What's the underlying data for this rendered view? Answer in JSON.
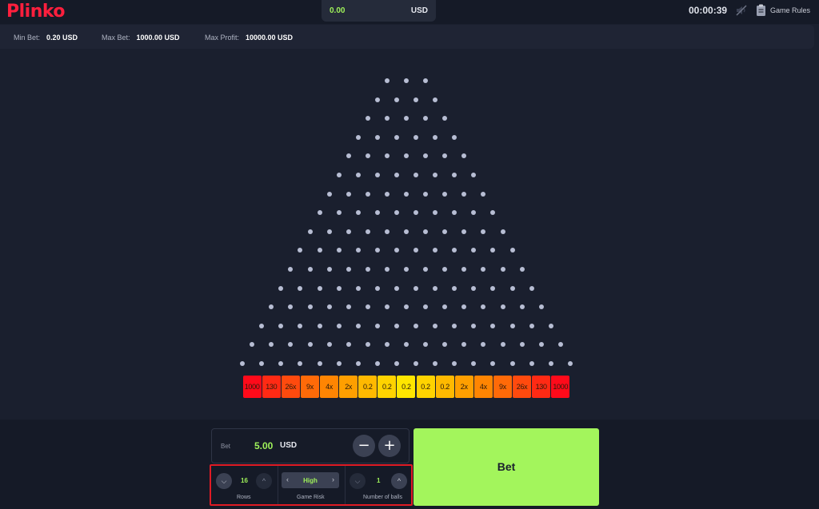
{
  "header": {
    "logo": "Plinko",
    "balance_amount": "0.00",
    "balance_currency": "USD",
    "timer": "00:00:39",
    "sound_icon": "sound-muted-icon",
    "rules_icon": "clipboard-icon",
    "rules_label": "Game Rules"
  },
  "limits": {
    "min_label": "Min Bet:",
    "min_value": "0.20 USD",
    "max_label": "Max Bet:",
    "max_value": "1000.00 USD",
    "profit_label": "Max Profit:",
    "profit_value": "10000.00 USD"
  },
  "board": {
    "rows": 16,
    "peg_color": "#b7bdd3",
    "multipliers": [
      "1000",
      "130",
      "26x",
      "9x",
      "4x",
      "2x",
      "0.2",
      "0.2",
      "0.2",
      "0.2",
      "0.2",
      "2x",
      "4x",
      "9x",
      "26x",
      "130",
      "1000"
    ],
    "bucket_colors": [
      "#ff0a1a",
      "#ff2a14",
      "#ff4a0e",
      "#ff6a08",
      "#ff8502",
      "#ff9f00",
      "#ffb900",
      "#ffd300",
      "#ffe600",
      "#ffd300",
      "#ffb900",
      "#ff9f00",
      "#ff8502",
      "#ff6a08",
      "#ff4a0e",
      "#ff2a14",
      "#ff0a1a"
    ]
  },
  "bet": {
    "label": "Bet",
    "amount": "5.00",
    "currency": "USD",
    "minus": "−",
    "plus": "+",
    "button": "Bet"
  },
  "settings": {
    "rows_value": "16",
    "rows_label": "Rows",
    "risk_value": "High",
    "risk_label": "Game Risk",
    "balls_value": "1",
    "balls_label": "Number of balls"
  },
  "colors": {
    "accent_green": "#9ff25a",
    "bet_button": "#a3f55c",
    "logo_red": "#ff1f3d",
    "highlight_border": "#e01b24"
  }
}
